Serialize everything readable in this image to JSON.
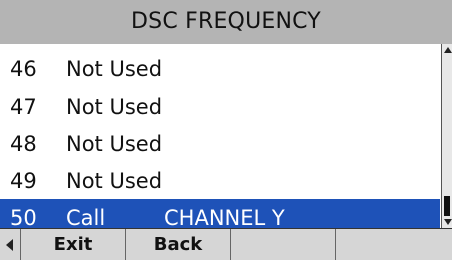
{
  "header": {
    "title": "DSC FREQUENCY"
  },
  "list": {
    "items": [
      {
        "number": "46",
        "label": "Not Used",
        "extra": ""
      },
      {
        "number": "47",
        "label": "Not Used",
        "extra": ""
      },
      {
        "number": "48",
        "label": "Not Used",
        "extra": ""
      },
      {
        "number": "49",
        "label": "Not Used",
        "extra": ""
      },
      {
        "number": "50",
        "label": "Call",
        "extra": "CHANNEL Y"
      }
    ],
    "selected_index": 4
  },
  "softkeys": {
    "key1": "Exit",
    "key2": "Back",
    "key3": "",
    "key4": ""
  },
  "icons": {
    "scroll_up": "triangle-up-icon",
    "scroll_down": "triangle-down-icon",
    "softkey_left": "triangle-left-icon"
  },
  "colors": {
    "title_bg": "#b4b4b4",
    "selected_bg": "#1e52b8",
    "softkey_bg": "#d6d6d6"
  }
}
